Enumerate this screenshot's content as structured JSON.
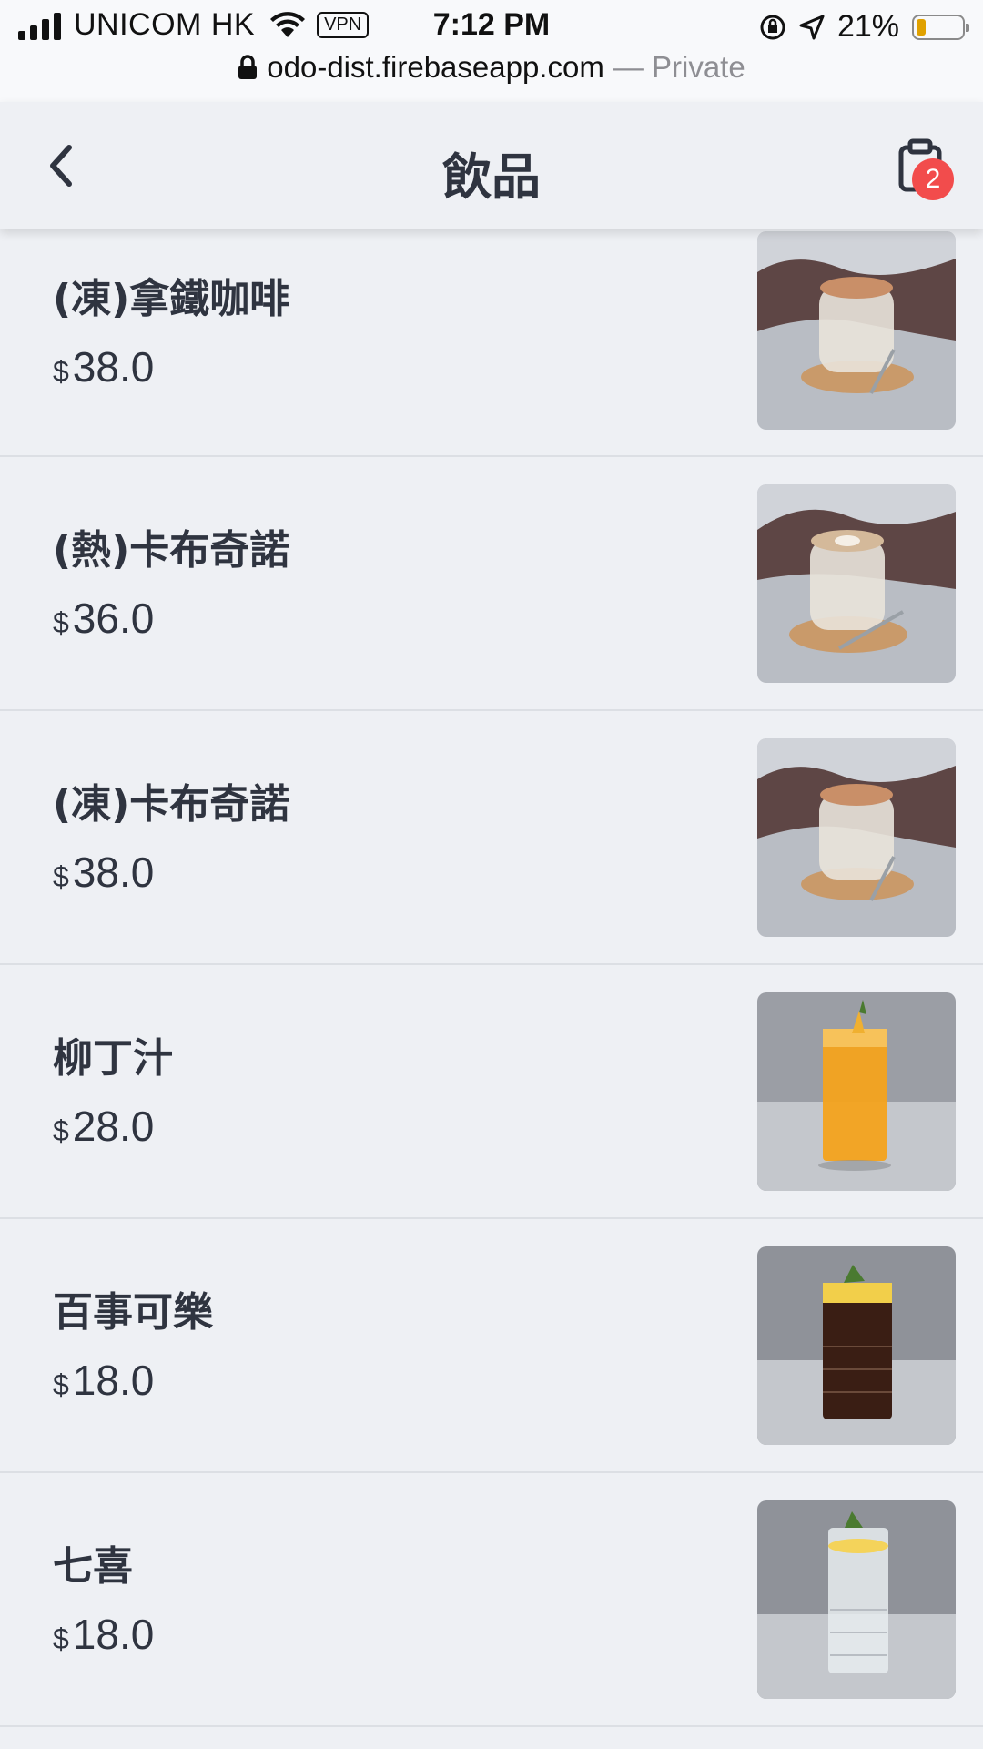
{
  "status_bar": {
    "carrier": "UNICOM HK",
    "vpn": "VPN",
    "time": "7:12 PM",
    "battery_percent": "21%",
    "battery_level": 0.21
  },
  "browser": {
    "url": "odo-dist.firebaseapp.com",
    "mode": "— Private"
  },
  "header": {
    "title": "飲品",
    "cart_count": "2"
  },
  "products": [
    {
      "name": "(凍)拿鐵咖啡",
      "currency": "$",
      "price": "38.0",
      "image": "iced-latte-photo"
    },
    {
      "name": "(熱)卡布奇諾",
      "currency": "$",
      "price": "36.0",
      "image": "hot-cappuccino-photo"
    },
    {
      "name": "(凍)卡布奇諾",
      "currency": "$",
      "price": "38.0",
      "image": "iced-cappuccino-photo"
    },
    {
      "name": "柳丁汁",
      "currency": "$",
      "price": "28.0",
      "image": "orange-juice-photo"
    },
    {
      "name": "百事可樂",
      "currency": "$",
      "price": "18.0",
      "image": "pepsi-photo"
    },
    {
      "name": "七喜",
      "currency": "$",
      "price": "18.0",
      "image": "7up-photo"
    }
  ],
  "colors": {
    "background": "#eef0f4",
    "text": "#2f3440",
    "badge": "#f24c4c",
    "battery": "#e0a100"
  }
}
